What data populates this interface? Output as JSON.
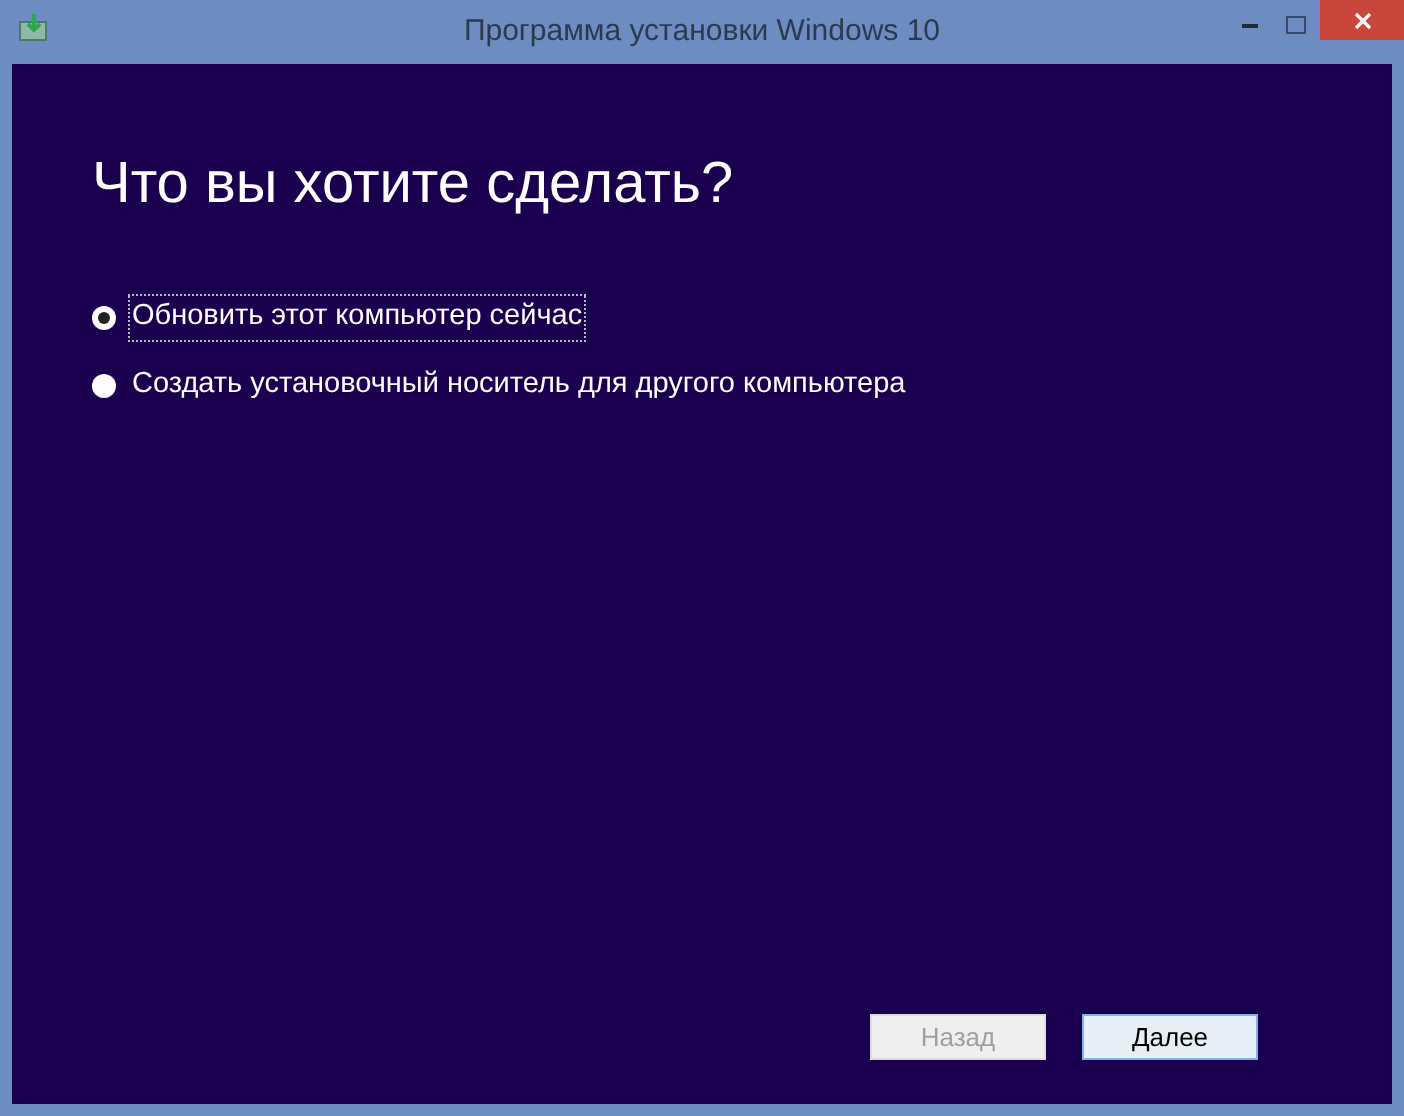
{
  "window": {
    "title": "Программа установки Windows 10"
  },
  "heading": "Что вы хотите сделать?",
  "options": [
    {
      "label": "Обновить этот компьютер сейчас",
      "selected": true
    },
    {
      "label": "Создать установочный носитель для другого компьютера",
      "selected": false
    }
  ],
  "buttons": [
    {
      "label": "Назад",
      "disabled": true
    },
    {
      "label": "Далее",
      "disabled": false
    }
  ]
}
